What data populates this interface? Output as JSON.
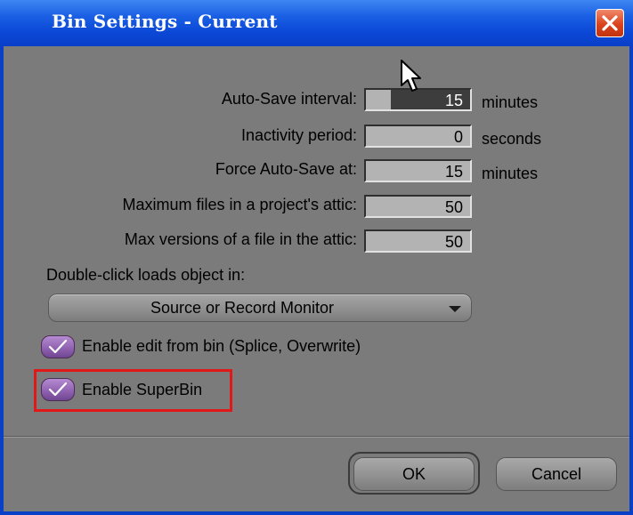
{
  "dialog": {
    "title": "Bin Settings - Current",
    "close_icon": "close-x-icon"
  },
  "settings": {
    "auto_save": {
      "label": "Auto-Save interval:",
      "value": "15",
      "unit": "minutes"
    },
    "inactivity": {
      "label": "Inactivity period:",
      "value": "0",
      "unit": "seconds"
    },
    "force_auto_save": {
      "label": "Force Auto-Save at:",
      "value": "15",
      "unit": "minutes"
    },
    "max_files": {
      "label": "Maximum files in a project's attic:",
      "value": "50"
    },
    "max_versions": {
      "label": "Max versions of a file in the attic:",
      "value": "50"
    }
  },
  "double_click": {
    "label": "Double-click loads object in:",
    "selected": "Source or Record Monitor"
  },
  "checkboxes": {
    "edit_from_bin": {
      "label": "Enable edit from bin (Splice, Overwrite)",
      "checked": true
    },
    "superbin": {
      "label": "Enable SuperBin",
      "checked": true
    }
  },
  "buttons": {
    "ok": "OK",
    "cancel": "Cancel"
  },
  "colors": {
    "titlebar": "#0a3fc8",
    "panel": "#7b7b7b",
    "checkbox": "#8e5fb0",
    "highlight": "#e01818",
    "close": "#d9431c"
  }
}
